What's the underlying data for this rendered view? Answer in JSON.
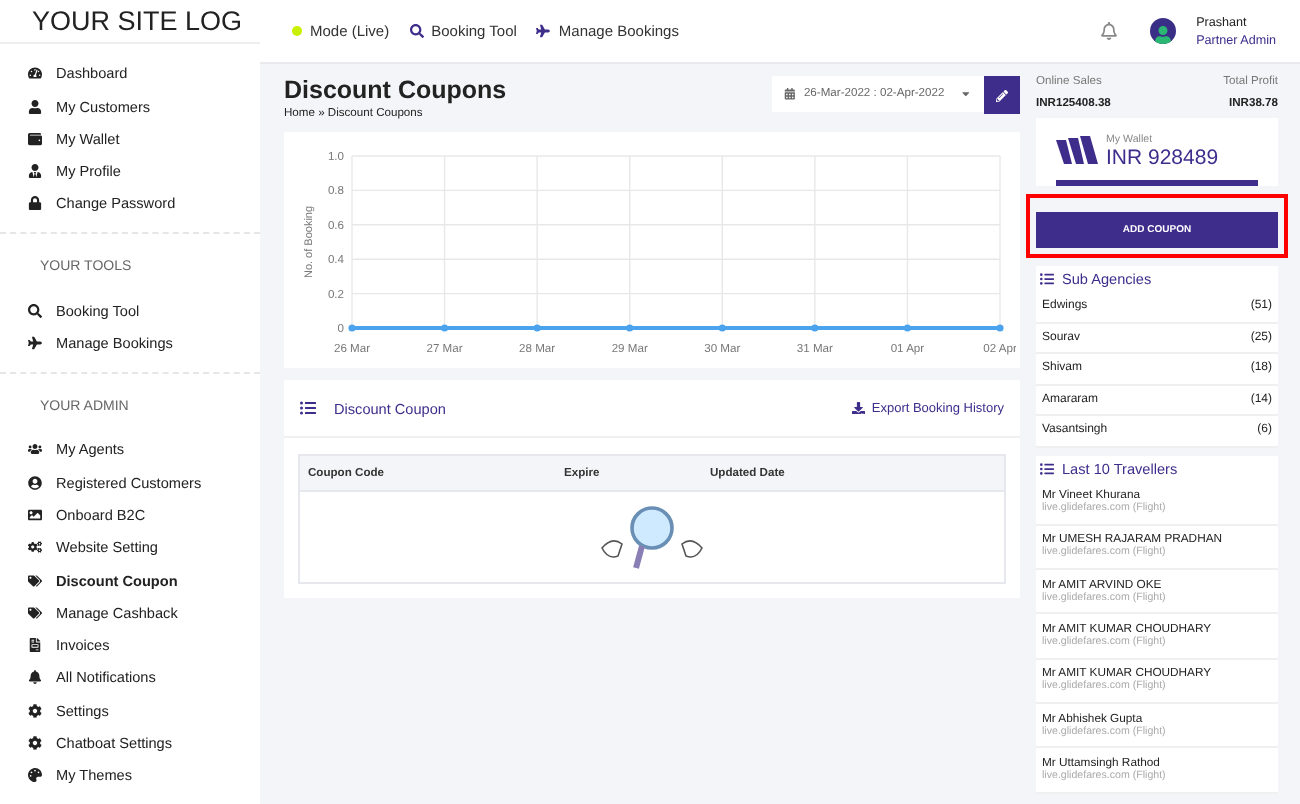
{
  "sidebar": {
    "logo": "YOUR SITE LOG",
    "sections": [
      {
        "items": [
          {
            "label": "Dashboard",
            "selected": false
          },
          {
            "label": "My Customers",
            "selected": false
          },
          {
            "label": "My Wallet",
            "selected": false
          },
          {
            "label": "My Profile",
            "selected": false
          },
          {
            "label": "Change Password",
            "selected": false
          }
        ]
      },
      {
        "heading": "YOUR TOOLS",
        "items": [
          {
            "label": "Booking Tool",
            "selected": false
          },
          {
            "label": "Manage Bookings",
            "selected": false
          }
        ]
      },
      {
        "heading": "YOUR ADMIN",
        "items": [
          {
            "label": "My Agents",
            "selected": false
          },
          {
            "label": "Registered Customers",
            "selected": false
          },
          {
            "label": "Onboard B2C",
            "selected": false
          },
          {
            "label": "Website Setting",
            "selected": false
          },
          {
            "label": "Discount Coupon",
            "selected": true
          },
          {
            "label": "Manage Cashback",
            "selected": false
          },
          {
            "label": "Invoices",
            "selected": false
          },
          {
            "label": "All Notifications",
            "selected": false
          },
          {
            "label": "Settings",
            "selected": false
          },
          {
            "label": "Chatboat Settings",
            "selected": false
          },
          {
            "label": "My Themes",
            "selected": false
          }
        ]
      }
    ]
  },
  "topbar": {
    "mode": "Mode (Live)",
    "links": [
      "Booking Tool",
      "Manage Bookings"
    ],
    "user": {
      "name": "Prashant",
      "role": "Partner Admin"
    }
  },
  "page": {
    "title": "Discount Coupons",
    "breadcrumb": "Home » Discount Coupons",
    "date_range": "26-Mar-2022 : 02-Apr-2022",
    "chart": {
      "chart_data": {
        "type": "line",
        "ylabel": "No. of Booking",
        "categories": [
          "26 Mar",
          "27 Mar",
          "28 Mar",
          "29 Mar",
          "30 Mar",
          "31 Mar",
          "01 Apr",
          "02 Apr"
        ],
        "series": [
          {
            "color": "#4aa3ec",
            "marker": "circle",
            "values": [
              0,
              0,
              0,
              0,
              0,
              0,
              0,
              0
            ]
          }
        ],
        "grid": true,
        "ylim": [
          0,
          1
        ],
        "yticks": [
          {
            "value": 0,
            "label": "0"
          },
          {
            "value": 0.2,
            "label": "0.2"
          },
          {
            "value": 0.4,
            "label": "0.4"
          },
          {
            "value": 0.6,
            "label": "0.6"
          },
          {
            "value": 0.8,
            "label": "0.8"
          },
          {
            "value": 1,
            "label": "1.0"
          }
        ]
      }
    },
    "coupons": {
      "title": "Discount Coupon",
      "export": "Export Booking History",
      "columns": [
        "Coupon Code",
        "Expire",
        "Updated Date"
      ]
    }
  },
  "summary": {
    "online_sales_label": "Online Sales",
    "online_sales": "INR125408.38",
    "profit_label": "Total Profit",
    "profit": "INR38.78"
  },
  "wallet": {
    "label": "My Wallet",
    "amount": "INR 928489"
  },
  "add_coupon": "ADD COUPON",
  "sub_agencies": {
    "title": "Sub Agencies",
    "items": [
      {
        "name": "Edwings",
        "count": "(51)"
      },
      {
        "name": "Sourav",
        "count": "(25)"
      },
      {
        "name": "Shivam",
        "count": "(18)"
      },
      {
        "name": "Amararam",
        "count": "(14)"
      },
      {
        "name": "Vasantsingh",
        "count": "(6)"
      }
    ]
  },
  "travellers": {
    "title": "Last 10 Travellers",
    "items": [
      {
        "name": "Mr Vineet Khurana",
        "source": "live.glidefares.com (Flight)"
      },
      {
        "name": "Mr UMESH RAJARAM PRADHAN",
        "source": "live.glidefares.com (Flight)"
      },
      {
        "name": "Mr AMIT ARVIND OKE",
        "source": "live.glidefares.com (Flight)"
      },
      {
        "name": "Mr AMIT KUMAR CHOUDHARY",
        "source": "live.glidefares.com (Flight)"
      },
      {
        "name": "Mr AMIT KUMAR CHOUDHARY",
        "source": "live.glidefares.com (Flight)"
      },
      {
        "name": "Mr Abhishek Gupta",
        "source": "live.glidefares.com (Flight)"
      },
      {
        "name": "Mr Uttamsingh Rathod",
        "source": "live.glidefares.com (Flight)"
      }
    ]
  }
}
